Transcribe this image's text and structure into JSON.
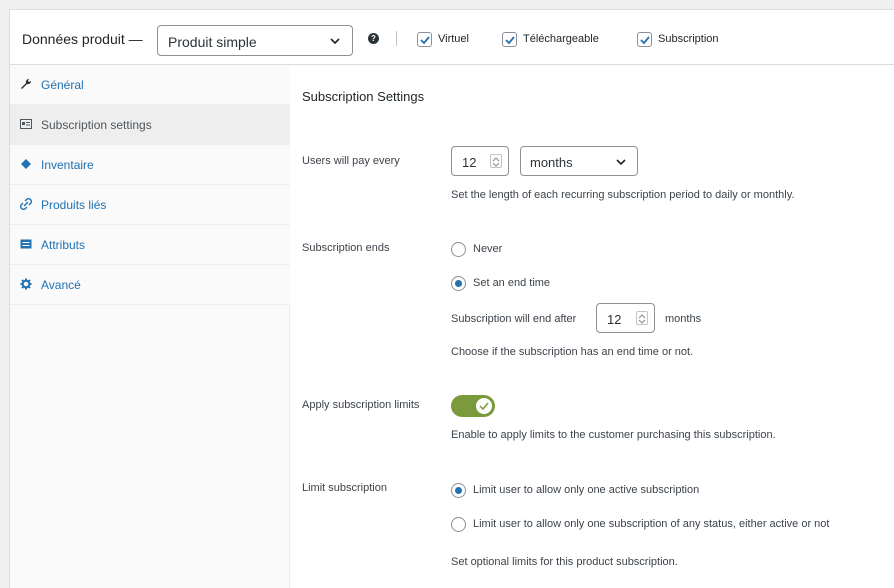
{
  "header": {
    "title": "Données produit —",
    "product_type": "Produit simple",
    "help_icon": "help-icon",
    "checkboxes": [
      {
        "label": "Virtuel",
        "checked": true
      },
      {
        "label": "Téléchargeable",
        "checked": true
      },
      {
        "label": "Subscription",
        "checked": true
      }
    ]
  },
  "sidebar": {
    "items": [
      {
        "label": "Général",
        "icon": "wrench-icon",
        "active": false
      },
      {
        "label": "Subscription settings",
        "icon": "card-icon",
        "active": true
      },
      {
        "label": "Inventaire",
        "icon": "tag-icon",
        "active": false
      },
      {
        "label": "Produits liés",
        "icon": "link-icon",
        "active": false
      },
      {
        "label": "Attributs",
        "icon": "list-icon",
        "active": false
      },
      {
        "label": "Avancé",
        "icon": "gear-icon",
        "active": false
      }
    ]
  },
  "main": {
    "section_title": "Subscription Settings",
    "pay_every": {
      "label": "Users will pay every",
      "value": "12",
      "unit": "months",
      "description": "Set the length of each recurring subscription period to daily or monthly."
    },
    "ends": {
      "label": "Subscription ends",
      "option_never": "Never",
      "option_end_time": "Set an end time",
      "selected": "Set an end time",
      "end_after_label": "Subscription will end after",
      "end_after_value": "12",
      "end_after_unit": "months",
      "description": "Choose if the subscription has an end time or not."
    },
    "limits": {
      "label": "Apply subscription limits",
      "enabled": true,
      "description": "Enable to apply limits to the customer purchasing this subscription."
    },
    "limit_subscription": {
      "label": "Limit subscription",
      "option_active": "Limit user to allow only one active subscription",
      "option_any": "Limit user to allow only one subscription of any status, either active or not",
      "selected": "Limit user to allow only one active subscription",
      "description": "Set optional limits for this product subscription."
    }
  },
  "colors": {
    "link": "#2271b1",
    "toggle_on": "#7a9a3c",
    "radio_on": "#2271b1"
  }
}
